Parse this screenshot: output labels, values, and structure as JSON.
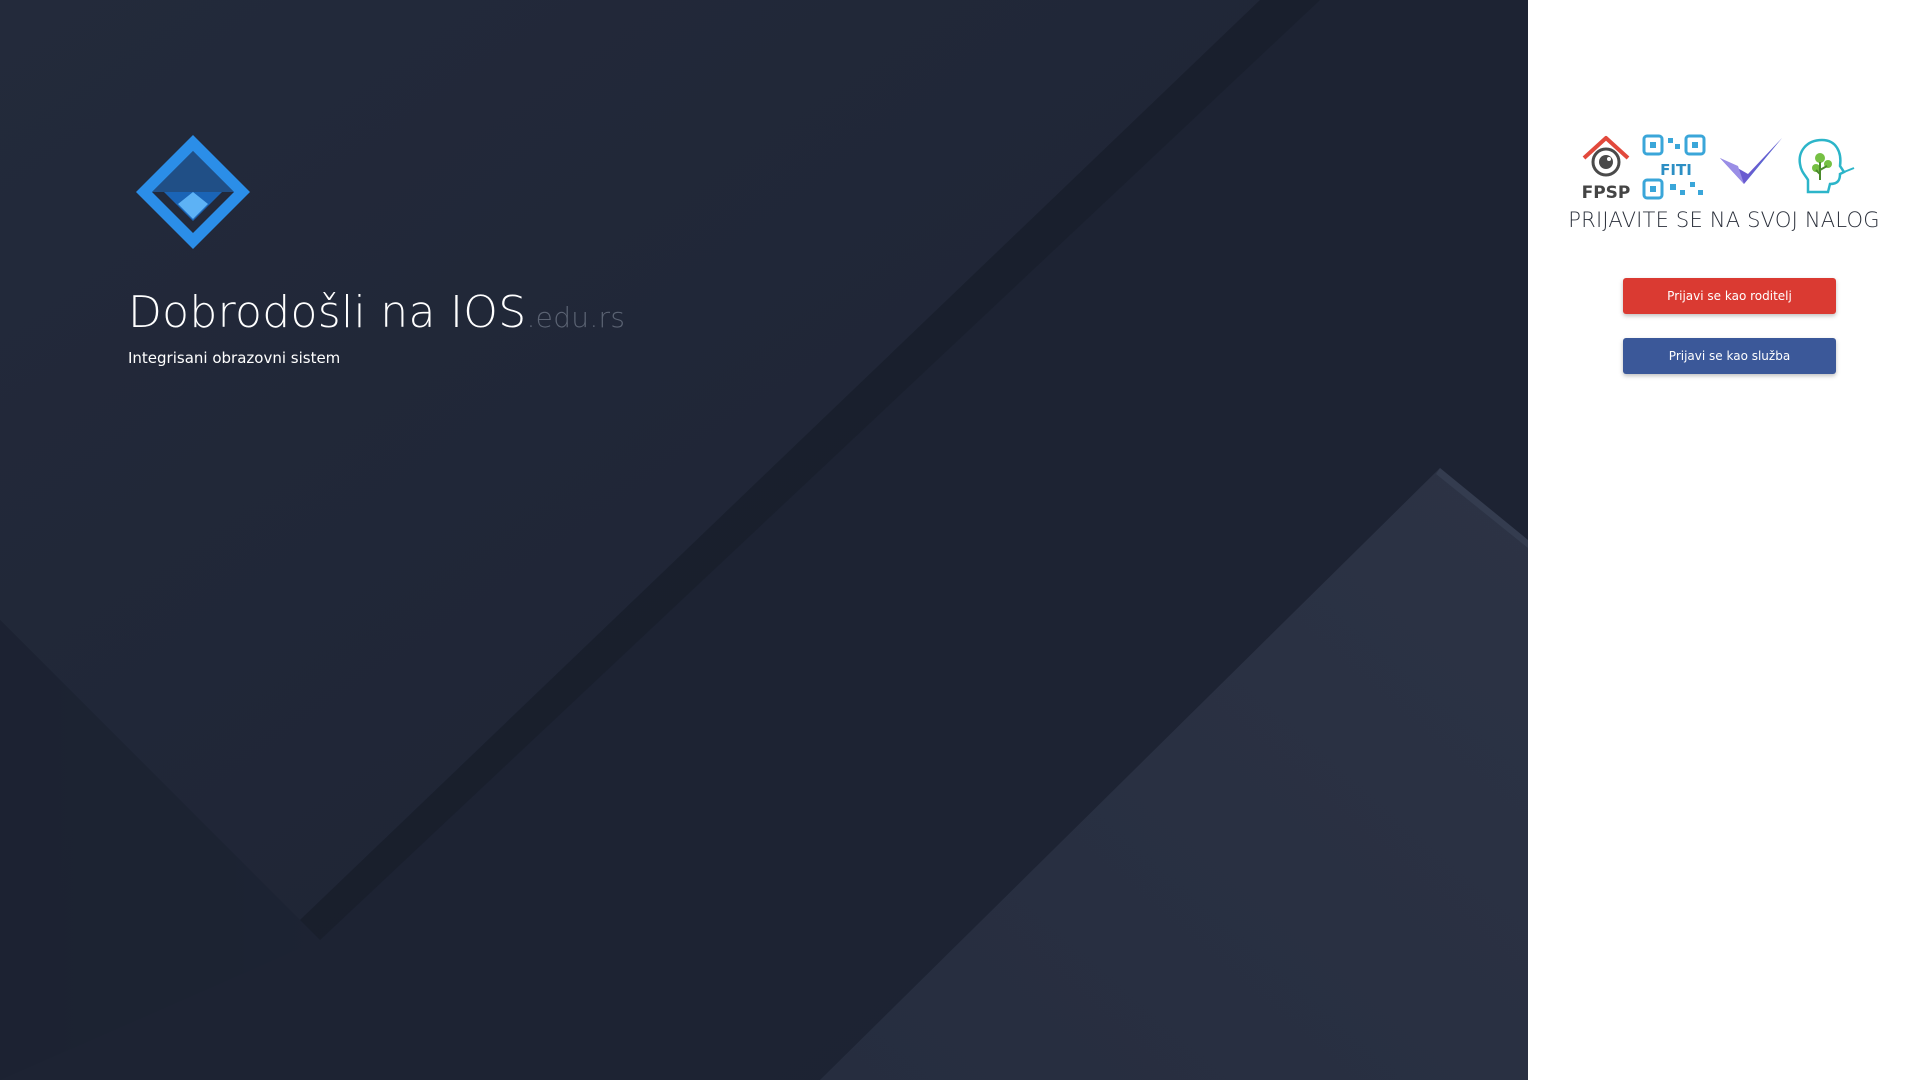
{
  "hero": {
    "title_main": "Dobrodošli na IOS",
    "title_suffix": ".edu.rs",
    "tagline": "Integrisani obrazovni sistem",
    "logo_icon": "ios-diamond-logo",
    "colors": {
      "background": "#1f2535",
      "logo_blue": "#2b8ee8",
      "suffix": "#5b6373"
    }
  },
  "login": {
    "partners": {
      "fpsp_label": "FPSP",
      "fiti_label": "FITI",
      "icons": [
        "fpsp-logo",
        "fiti-qr-logo",
        "checkmark-logo",
        "head-tree-logo"
      ]
    },
    "title": "PRIJAVITE SE NA SVOJ NALOG",
    "parent_button": "Prijavi se kao roditelj",
    "staff_button": "Prijavi se kao služba",
    "colors": {
      "parent_button": "#da3a32",
      "staff_button": "#3b5899"
    }
  }
}
